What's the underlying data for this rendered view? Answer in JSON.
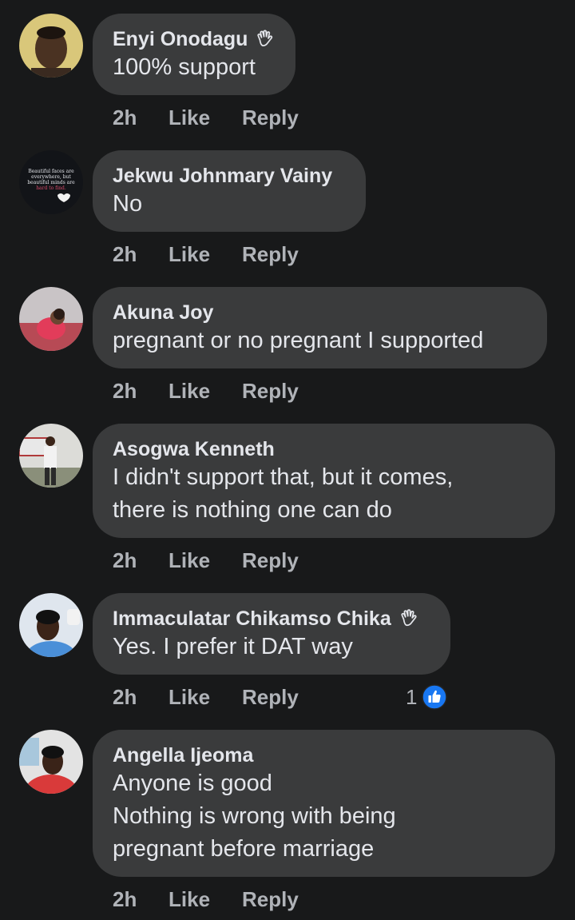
{
  "comments": [
    {
      "author": "Enyi Onodagu",
      "badge": "wave-icon",
      "lines": [
        "100% support"
      ],
      "time": "2h",
      "like": "Like",
      "reply": "Reply"
    },
    {
      "author": "Jekwu Johnmary Vainy",
      "lines": [
        "No"
      ],
      "time": "2h",
      "like": "Like",
      "reply": "Reply",
      "avatar_text": [
        "Beautiful faces are",
        "everywhere, but",
        "beautiful minds are",
        "hard to find."
      ]
    },
    {
      "author": "Akuna Joy",
      "lines": [
        "pregnant or no pregnant I supported"
      ],
      "time": "2h",
      "like": "Like",
      "reply": "Reply"
    },
    {
      "author": "Asogwa Kenneth",
      "lines": [
        "I didn't support that, but it comes,",
        "there is nothing one can do"
      ],
      "time": "2h",
      "like": "Like",
      "reply": "Reply"
    },
    {
      "author": "Immaculatar Chikamso Chika",
      "badge": "wave-icon",
      "lines": [
        "Yes. I prefer it DAT way"
      ],
      "time": "2h",
      "like": "Like",
      "reply": "Reply",
      "reaction_count": "1",
      "reaction_icon": "thumbs-up-icon"
    },
    {
      "author": "Angella Ijeoma",
      "lines": [
        "Anyone is good",
        "Nothing is wrong with being",
        "pregnant before marriage"
      ],
      "time": "2h",
      "like": "Like",
      "reply": "Reply"
    }
  ],
  "colors": {
    "background": "#18191a",
    "bubble": "#3a3b3c",
    "text": "#e4e6eb",
    "secondary_text": "#b0b3b8",
    "reaction_blue": "#1877f2"
  }
}
